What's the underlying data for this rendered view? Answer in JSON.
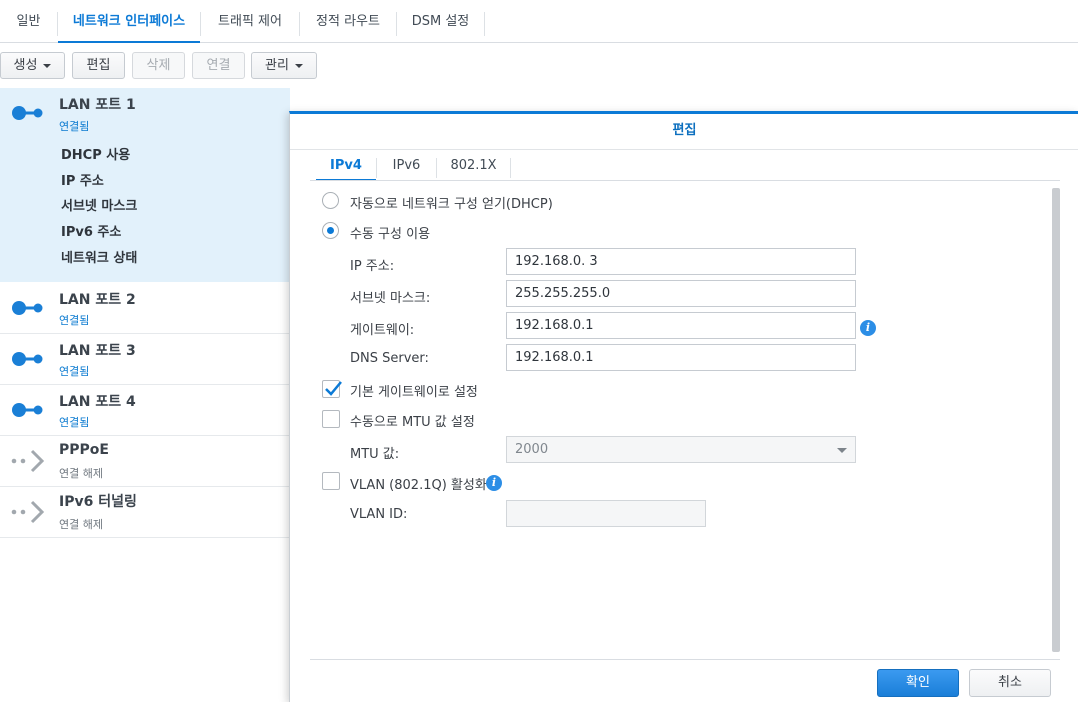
{
  "top_tabs": {
    "general": "일반",
    "network_interface": "네트워크 인터페이스",
    "traffic_control": "트래픽 제어",
    "static_route": "정적 라우트",
    "dsm_settings": "DSM 설정"
  },
  "toolbar": {
    "create": "생성",
    "edit": "편집",
    "delete": "삭제",
    "connect": "연결",
    "manage": "관리"
  },
  "interfaces": [
    {
      "name": "LAN 포트 1",
      "status": "연결됨"
    },
    {
      "name": "LAN 포트 2",
      "status": "연결됨"
    },
    {
      "name": "LAN 포트 3",
      "status": "연결됨"
    },
    {
      "name": "LAN 포트 4",
      "status": "연결됨"
    },
    {
      "name": "PPPoE",
      "status": "연결 해제"
    },
    {
      "name": "IPv6 터널링",
      "status": "연결 해제"
    }
  ],
  "selected_details": {
    "dhcp": "DHCP 사용",
    "ip": "IP 주소",
    "subnet": "서브넷 마스크",
    "ipv6": "IPv6 주소",
    "net_status": "네트워크 상태"
  },
  "dialog": {
    "title": "편집",
    "tabs": {
      "ipv4": "IPv4",
      "ipv6": "IPv6",
      "dot1x": "802.1X"
    },
    "auto_dhcp_label": "자동으로 네트워크 구성 얻기(DHCP)",
    "manual_label": "수동 구성 이용",
    "ip_label": "IP 주소:",
    "ip_value": "192.168.0.  3",
    "subnet_label": "서브넷 마스크:",
    "subnet_value": "255.255.255.0",
    "gateway_label": "게이트웨이:",
    "gateway_value": "192.168.0.1",
    "dns_label": "DNS Server:",
    "dns_value": "192.168.0.1",
    "default_gateway_label": "기본 게이트웨이로 설정",
    "manual_mtu_label": "수동으로 MTU 값 설정",
    "mtu_label": "MTU 값:",
    "mtu_value": "2000",
    "vlan_label": "VLAN (802.1Q) 활성화",
    "vlan_id_label": "VLAN ID:",
    "vlan_id_value": "",
    "ok": "확인",
    "cancel": "취소"
  },
  "accent_color": "#0c7ad6"
}
